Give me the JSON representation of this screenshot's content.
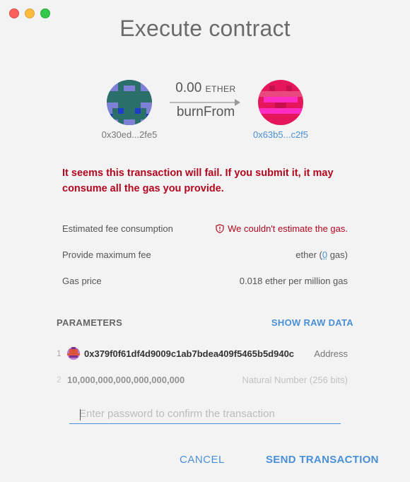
{
  "window": {
    "title": "Execute contract"
  },
  "transfer": {
    "from_address": "0x30ed...2fe5",
    "to_address": "0x63b5...c2f5",
    "amount": "0.00",
    "unit": "ETHER",
    "method": "burnFrom"
  },
  "warning": "It seems this transaction will fail. If you submit it, it may consume all the gas you provide.",
  "fees": {
    "estimated_label": "Estimated fee consumption",
    "estimated_value": "We couldn't estimate the gas.",
    "max_label": "Provide maximum fee",
    "max_prefix": "ether (",
    "max_gas": "0",
    "max_suffix": " gas)",
    "price_label": "Gas price",
    "price_value": "0.018 ether per million gas"
  },
  "parameters": {
    "heading": "PARAMETERS",
    "raw_data_label": "SHOW RAW DATA",
    "items": [
      {
        "index": "1",
        "value": "0x379f0f61df4d9009c1ab7bdea409f5465b5d940c",
        "type": "Address"
      },
      {
        "index": "2",
        "value": "10,000,000,000,000,000,000",
        "type": "Natural Number (256 bits)"
      }
    ]
  },
  "password": {
    "placeholder": "Enter password to confirm the transaction",
    "value": ""
  },
  "actions": {
    "cancel": "CANCEL",
    "send": "SEND TRANSACTION"
  },
  "colors": {
    "accent": "#4a90d9",
    "error": "#b3071f",
    "background": "#f3f3f3"
  }
}
